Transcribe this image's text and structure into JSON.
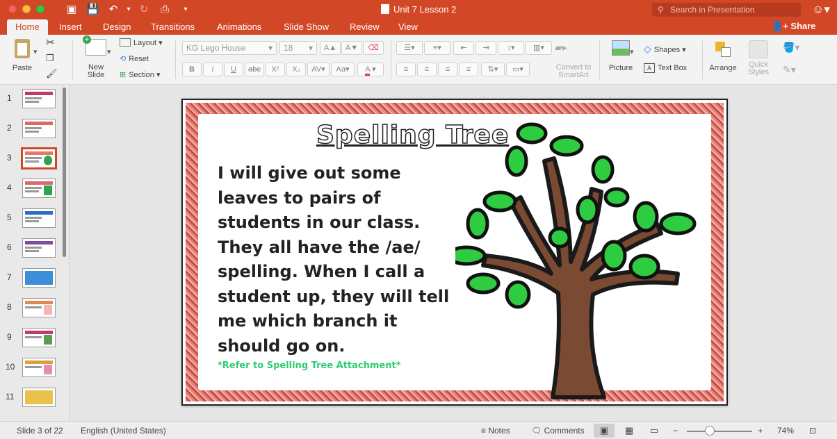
{
  "window": {
    "title": "Unit 7 Lesson 2",
    "search_placeholder": "Search in Presentation",
    "share_label": "Share"
  },
  "tabs": [
    "Home",
    "Insert",
    "Design",
    "Transitions",
    "Animations",
    "Slide Show",
    "Review",
    "View"
  ],
  "ribbon": {
    "paste": "Paste",
    "new_slide": "New\nSlide",
    "new_slide_l1": "New",
    "new_slide_l2": "Slide",
    "layout": "Layout",
    "reset": "Reset",
    "section": "Section",
    "font_name": "KG Lego House",
    "font_size": "18",
    "convert_l1": "Convert to",
    "convert_l2": "SmartArt",
    "picture": "Picture",
    "shapes": "Shapes",
    "text_box": "Text Box",
    "arrange": "Arrange",
    "quick_l1": "Quick",
    "quick_l2": "Styles",
    "bold": "B",
    "italic": "I",
    "underline": "U",
    "strike": "abc",
    "superscript": "X²",
    "subscript": "X₂"
  },
  "thumbnails": [
    {
      "num": "1",
      "accent": "#c23a6b"
    },
    {
      "num": "2",
      "accent": "#d96b6b"
    },
    {
      "num": "3",
      "accent": "#2ea44f",
      "selected": true
    },
    {
      "num": "4",
      "accent": "#d96b6b"
    },
    {
      "num": "5",
      "accent": "#2b6cc4"
    },
    {
      "num": "6",
      "accent": "#7b4fa0"
    },
    {
      "num": "7",
      "accent": "#3a8fd8"
    },
    {
      "num": "8",
      "accent": "#e08a5a"
    },
    {
      "num": "9",
      "accent": "#c23a6b"
    },
    {
      "num": "10",
      "accent": "#d9a03b"
    },
    {
      "num": "11",
      "accent": "#e8c24a"
    }
  ],
  "slide": {
    "title": "Spelling Tree",
    "body": "I will give out some leaves to pairs of students in our class. They all have the /ae/ spelling. When I call a student up, they will tell me which branch it should go on.",
    "reference": "*Refer to Spelling Tree Attachment*"
  },
  "status": {
    "slide_position": "Slide 3 of 22",
    "language": "English (United States)",
    "notes": "Notes",
    "comments": "Comments",
    "zoom": "74%"
  },
  "colors": {
    "accent": "#d24726",
    "leaf_green": "#2ecc40",
    "trunk_brown": "#7a4a33",
    "reference_green": "#2ecc71"
  }
}
